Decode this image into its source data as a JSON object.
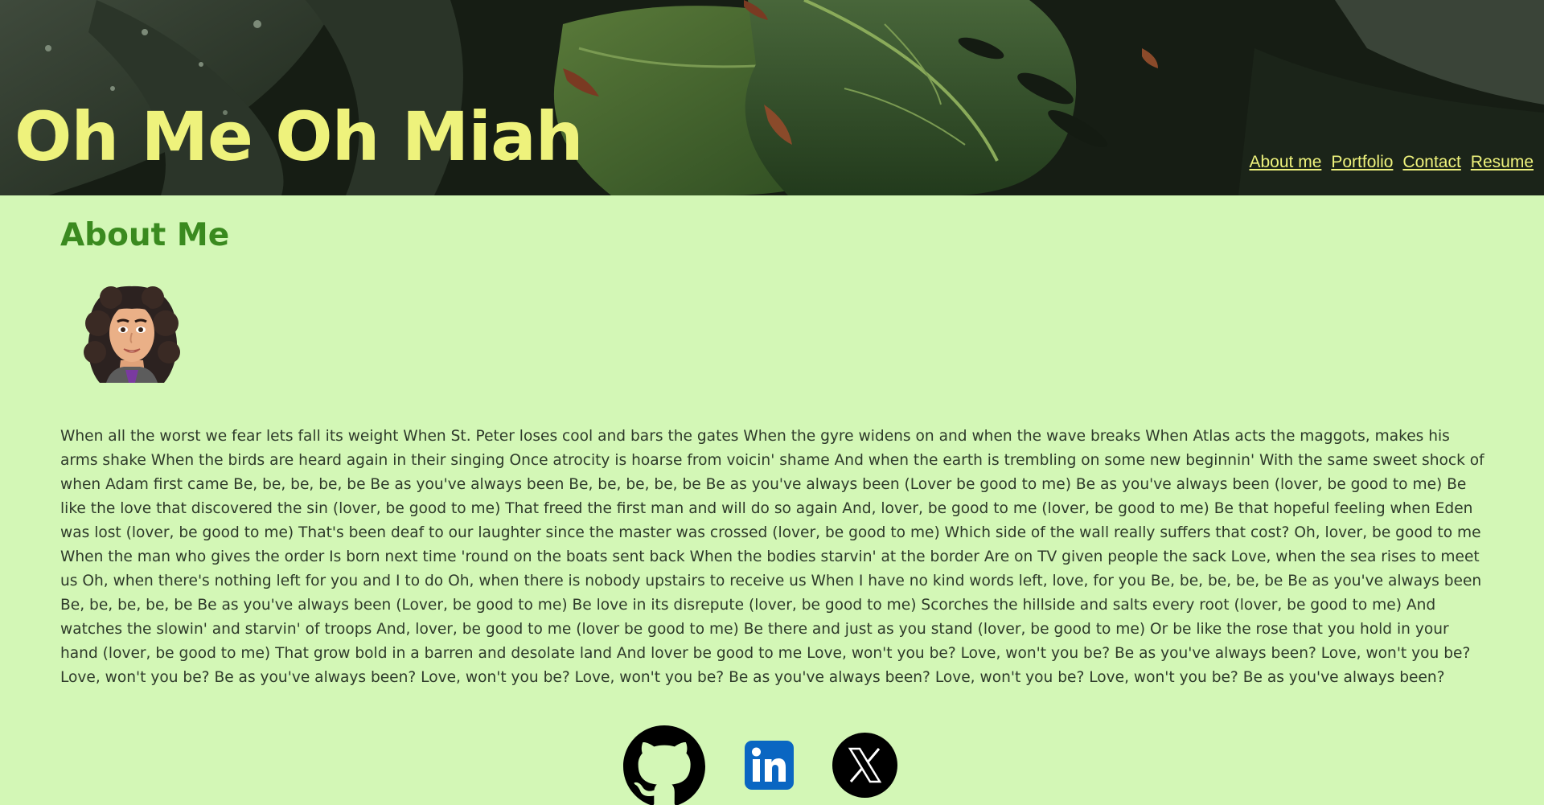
{
  "header": {
    "title": "Oh Me Oh Miah",
    "background": "tropical monstera leaves photo",
    "title_color": "#eef27c"
  },
  "nav": {
    "items": [
      {
        "label": "About me"
      },
      {
        "label": "Portfolio"
      },
      {
        "label": "Contact"
      },
      {
        "label": "Resume"
      }
    ]
  },
  "about": {
    "heading": "About Me",
    "heading_color": "#3a8a1f",
    "bio": "When all the worst we fear lets fall its weight When St. Peter loses cool and bars the gates When the gyre widens on and when the wave breaks When Atlas acts the maggots, makes his arms shake When the birds are heard again in their singing Once atrocity is hoarse from voicin' shame And when the earth is trembling on some new beginnin' With the same sweet shock of when Adam first came Be, be, be, be, be Be as you've always been Be, be, be, be, be Be as you've always been (Lover be good to me) Be as you've always been (lover, be good to me) Be like the love that discovered the sin (lover, be good to me) That freed the first man and will do so again And, lover, be good to me (lover, be good to me) Be that hopeful feeling when Eden was lost (lover, be good to me) That's been deaf to our laughter since the master was crossed (lover, be good to me) Which side of the wall really suffers that cost? Oh, lover, be good to me When the man who gives the order Is born next time 'round on the boats sent back When the bodies starvin' at the border Are on TV given people the sack Love, when the sea rises to meet us Oh, when there's nothing left for you and I to do Oh, when there is nobody upstairs to receive us When I have no kind words left, love, for you Be, be, be, be, be Be as you've always been Be, be, be, be, be Be as you've always been (Lover, be good to me) Be love in its disrepute (lover, be good to me) Scorches the hillside and salts every root (lover, be good to me) And watches the slowin' and starvin' of troops And, lover, be good to me (lover be good to me) Be there and just as you stand (lover, be good to me) Or be like the rose that you hold in your hand (lover, be good to me) That grow bold in a barren and desolate land And lover be good to me Love, won't you be? Love, won't you be? Be as you've always been? Love, won't you be? Love, won't you be? Be as you've always been? Love, won't you be? Love, won't you be? Be as you've always been? Love, won't you be? Love, won't you be? Be as you've always been?",
    "avatar": "avatar-icon"
  },
  "socials": [
    {
      "name": "github",
      "icon": "github-icon"
    },
    {
      "name": "linkedin",
      "icon": "linkedin-icon",
      "color": "#0a66c2"
    },
    {
      "name": "x",
      "icon": "x-icon"
    }
  ],
  "colors": {
    "page_background": "#d3f7b6",
    "text": "#2e3a2a"
  }
}
